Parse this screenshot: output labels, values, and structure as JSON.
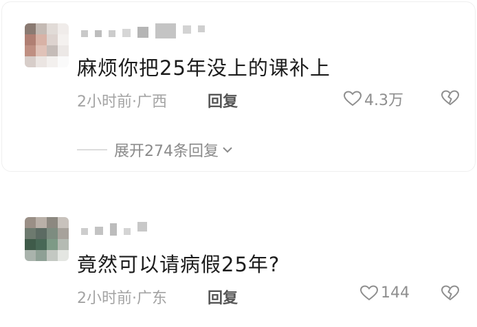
{
  "comments": [
    {
      "text": "麻烦你把25年没上的课补上",
      "time_location": "2小时前·广西",
      "reply_label": "回复",
      "likes": "4.3万",
      "expand_label": "展开274条回复",
      "avatar_colors": [
        "#8a7a72",
        "#c4bab4",
        "#e1dbd7",
        "#f0ecea",
        "#b07f73",
        "#d8b2a6",
        "#ddd3cf",
        "#f4f1ef",
        "#bf8f82",
        "#e0c2b8",
        "#c5bcb8",
        "#ece8e6",
        "#d7cdc9",
        "#ebe5e2",
        "#f3f0ee",
        "#fafafa"
      ]
    },
    {
      "text": "竟然可以请病假25年?",
      "time_location": "2小时前·广东",
      "reply_label": "回复",
      "likes": "144",
      "avatar_colors": [
        "#9a8f86",
        "#b9b0a8",
        "#8c8880",
        "#c8c2bc",
        "#6d7a6f",
        "#5c6b63",
        "#7d8c80",
        "#a7a29b",
        "#3f5b4a",
        "#486856",
        "#7d9a86",
        "#b5bbb3",
        "#a9b3ac",
        "#8ea095",
        "#c3c8c2",
        "#e4e6e2"
      ]
    }
  ],
  "icons": {
    "like": "heart-outline-icon",
    "dislike": "broken-heart-icon",
    "expand": "chevron-down-icon"
  }
}
